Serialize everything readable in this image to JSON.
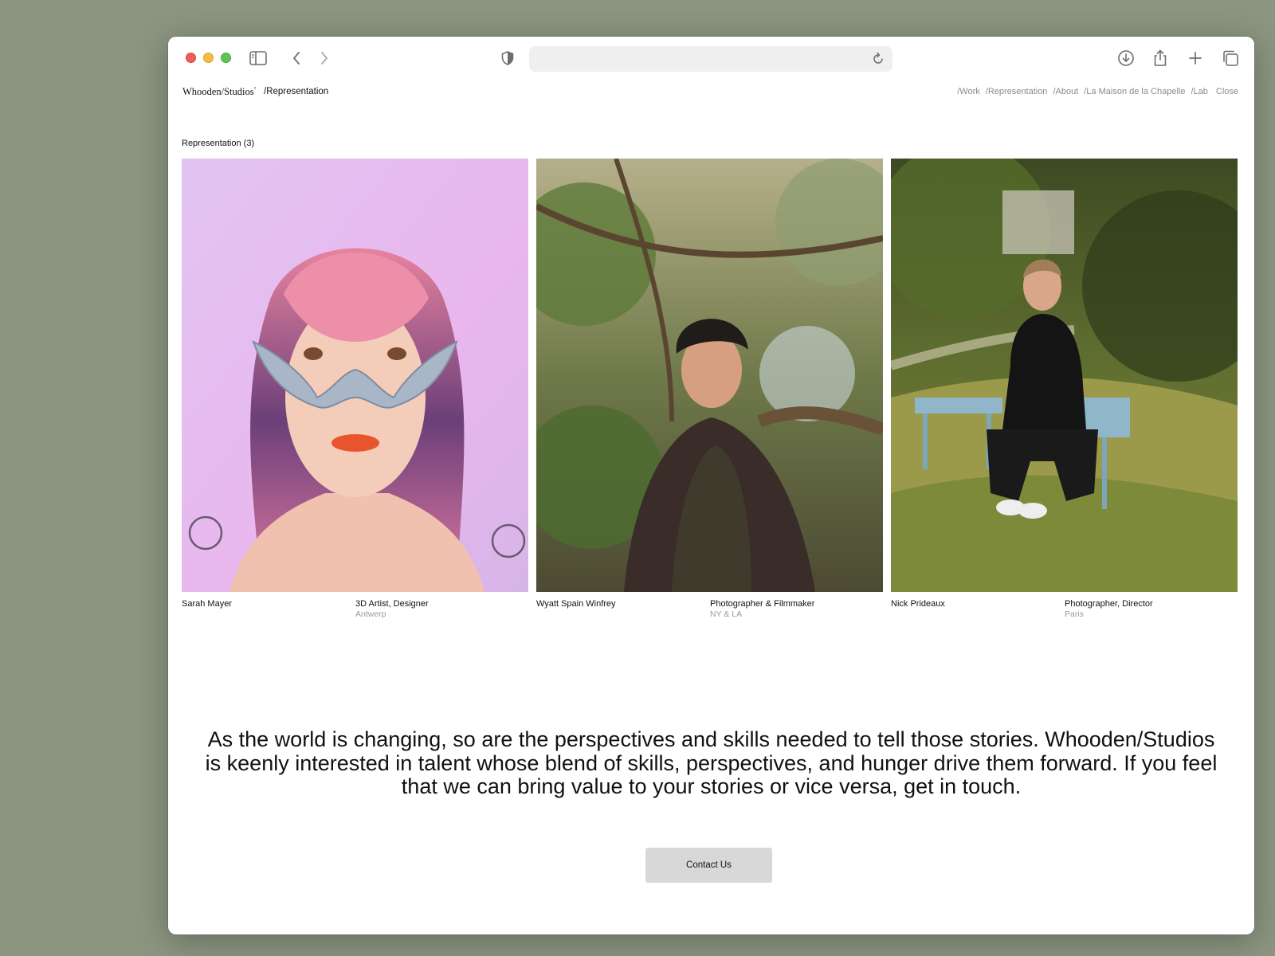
{
  "browser": {
    "url": "",
    "icons": [
      "sidebar-icon",
      "back-icon",
      "forward-icon",
      "shield-icon",
      "reload-icon",
      "download-icon",
      "share-icon",
      "new-tab-icon",
      "tabs-overview-icon"
    ]
  },
  "site": {
    "brand": "Whooden/Studios",
    "brand_mark": "°",
    "crumb": "/Representation",
    "nav": [
      "/Work",
      "/Representation",
      "/About",
      "/La Maison de la Chapelle",
      "/Lab",
      "Close"
    ]
  },
  "section": {
    "title": "Representation (3)"
  },
  "artists": [
    {
      "name": "Sarah Mayer",
      "role": "3D Artist, Designer",
      "location": "Antwerp"
    },
    {
      "name": "Wyatt Spain Winfrey",
      "role": "Photographer & Filmmaker",
      "location": "NY & LA"
    },
    {
      "name": "Nick Prideaux",
      "role": "Photographer, Director",
      "location": "Paris"
    }
  ],
  "statement": "As the world is changing, so are the perspectives and skills needed to tell those stories. Whooden/Studios is keenly interested in talent whose blend of skills, perspectives, and hunger drive them forward. If you feel that we can bring value to your stories or vice versa, get in touch.",
  "contact_label": "Contact Us",
  "colors": {
    "background": "#8b9580",
    "button": "#d8d8d8",
    "muted_text": "#9a9a9a"
  }
}
